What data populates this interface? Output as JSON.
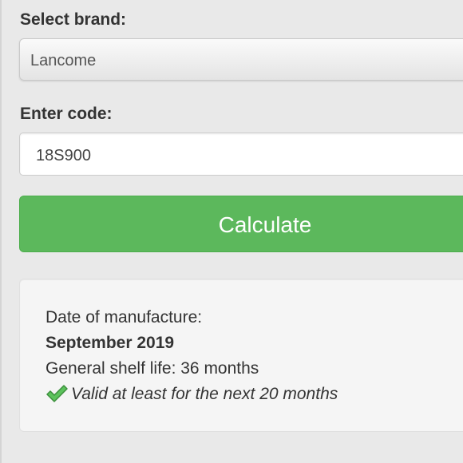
{
  "form": {
    "brand_label": "Select brand:",
    "brand_value": "Lancome",
    "code_label": "Enter code:",
    "code_value": "18S900",
    "calculate_label": "Calculate"
  },
  "result": {
    "manufacture_label": "Date of manufacture:",
    "manufacture_value": "September 2019",
    "shelf_life": "General shelf life: 36 months",
    "validity_icon": "checkmark-icon",
    "validity": "Valid at least for the next 20 months"
  },
  "colors": {
    "button": "#5cb85c",
    "check": "#4cae4c"
  }
}
